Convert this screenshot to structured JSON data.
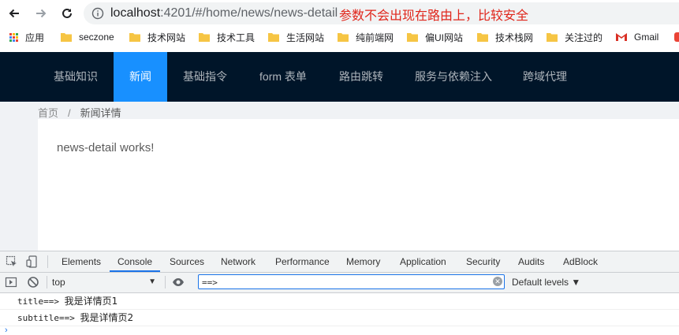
{
  "browser": {
    "url_host": "localhost",
    "url_path": ":4201/#/home/news/news-detail",
    "annotation": "参数不会出现在路由上，比较安全"
  },
  "bookmarks": [
    {
      "label": "应用",
      "icon": "apps-grid-icon"
    },
    {
      "label": "seczone",
      "icon": "folder-icon"
    },
    {
      "label": "技术网站",
      "icon": "folder-icon"
    },
    {
      "label": "技术工具",
      "icon": "folder-icon"
    },
    {
      "label": "生活网站",
      "icon": "folder-icon"
    },
    {
      "label": "纯前端网",
      "icon": "folder-icon"
    },
    {
      "label": "偏UI网站",
      "icon": "folder-icon"
    },
    {
      "label": "技术栈网",
      "icon": "folder-icon"
    },
    {
      "label": "关注过的",
      "icon": "folder-icon"
    },
    {
      "label": "Gmail",
      "icon": "gmail-icon"
    }
  ],
  "menu": {
    "items": [
      "基础知识",
      "新闻",
      "基础指令",
      "form 表单",
      "路由跳转",
      "服务与依赖注入",
      "跨域代理"
    ],
    "active": "新闻"
  },
  "breadcrumb": {
    "home": "首页",
    "separator": "/",
    "current": "新闻详情"
  },
  "content": {
    "text": "news-detail works!"
  },
  "devtools": {
    "tabs": [
      "Elements",
      "Console",
      "Sources",
      "Network",
      "Performance",
      "Memory",
      "Application",
      "Security",
      "Audits",
      "AdBlock"
    ],
    "active_tab": "Console",
    "context": "top",
    "filter_value": "==>",
    "levels": "Default levels ▼",
    "logs": [
      {
        "key": "title==>",
        "value": "我是详情页1"
      },
      {
        "key": "subtitle==>",
        "value": "我是详情页2"
      }
    ],
    "prompt": "›"
  },
  "colors": {
    "header_bg": "#001529",
    "active_menu": "#1890ff",
    "annotation": "#e0261b",
    "folder": "#f6c544",
    "devtools_accent": "#1a73e8"
  }
}
